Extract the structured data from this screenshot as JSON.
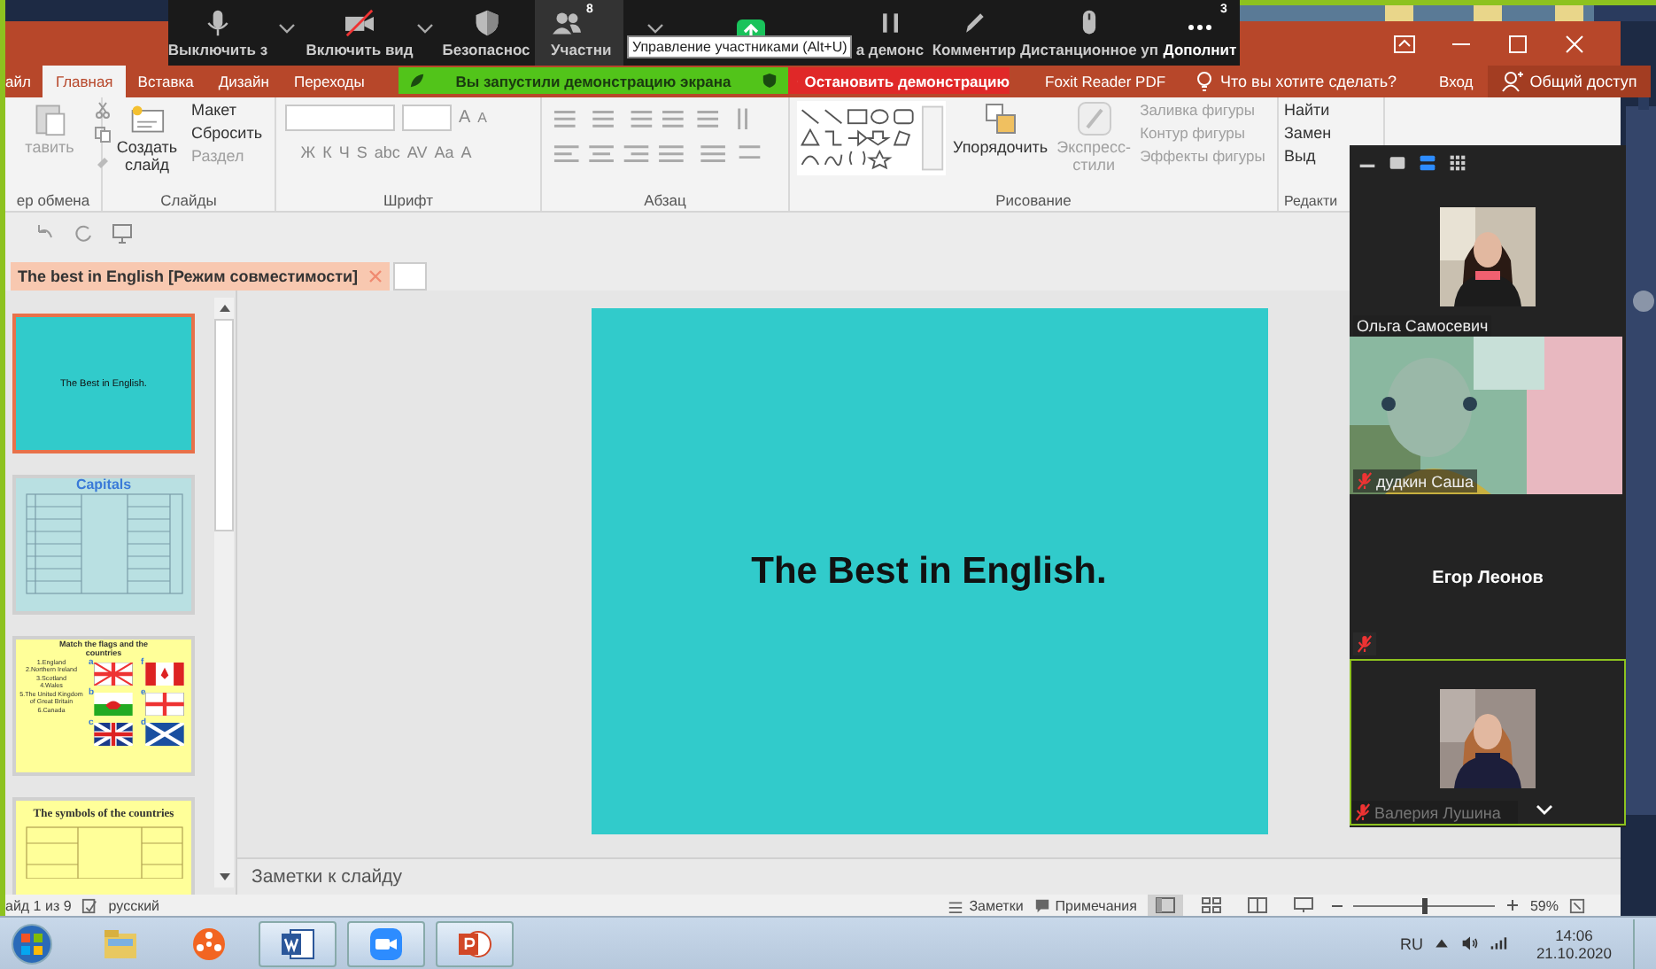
{
  "zoom_toolbar": {
    "buttons": [
      {
        "kind": "mic",
        "label": "Выключить з",
        "menu": true,
        "selected": false
      },
      {
        "kind": "video-off",
        "label": "Включить вид",
        "menu": true,
        "selected": false
      },
      {
        "kind": "shield",
        "label": "Безопаснос",
        "menu": false,
        "selected": false
      },
      {
        "kind": "participants",
        "label": "Участни",
        "badge": "8",
        "menu": true,
        "selected": true
      },
      {
        "kind": "share",
        "menu": false,
        "selected": false
      },
      {
        "kind": "pause",
        "label": "а демонс",
        "menu": false,
        "selected": false
      },
      {
        "kind": "pen",
        "label": "Комментир",
        "menu": false,
        "selected": false
      },
      {
        "kind": "remote",
        "label": "Дистанционное уп",
        "menu": false,
        "selected": false
      },
      {
        "kind": "more",
        "label": "Дополнит",
        "badge": "3",
        "menu": false,
        "selected": false
      }
    ],
    "tooltip": "Управление участниками (Alt+U)"
  },
  "share_banner": {
    "text": "Вы запустили демонстрацию экрана",
    "stop_button": "Остановить демонстрацию"
  },
  "powerpoint": {
    "tabs": [
      {
        "label": "айл",
        "selected": false
      },
      {
        "label": "Главная",
        "selected": true
      },
      {
        "label": "Вставка",
        "selected": false
      },
      {
        "label": "Дизайн",
        "selected": false
      },
      {
        "label": "Переходы",
        "selected": false
      }
    ],
    "foxit_tab": "Foxit Reader PDF",
    "tell_me": "Что вы хотите сделать?",
    "sign_in": "Вход",
    "share": "Общий доступ",
    "ribbon": [
      {
        "kind": "clipboard",
        "label": "ер обмена",
        "paste": "тавить"
      },
      {
        "kind": "slides",
        "label": "Слайды",
        "new_slide": "Создать слайд",
        "items": [
          {
            "label": "Макет",
            "disabled": false
          },
          {
            "label": "Сбросить",
            "disabled": false
          },
          {
            "label": "Раздел",
            "disabled": true
          }
        ]
      },
      {
        "kind": "font",
        "label": "Шрифт",
        "size_buttons": [
          "A",
          "A"
        ],
        "buttons": [
          "Ж",
          "К",
          "Ч",
          "S",
          "abc",
          "AV",
          "Aa",
          "A"
        ]
      },
      {
        "kind": "paragraph",
        "label": "Абзац"
      },
      {
        "kind": "drawing",
        "label": "Рисование",
        "arrange": "Упорядочить",
        "styles": "Экспресс-стили",
        "items": [
          {
            "label": "Заливка фигуры",
            "disabled": true
          },
          {
            "label": "Контур фигуры",
            "disabled": true
          },
          {
            "label": "Эффекты фигуры",
            "disabled": true
          }
        ]
      },
      {
        "kind": "editing",
        "label": "Редакти",
        "items": [
          {
            "label": "Найти",
            "disabled": false
          },
          {
            "label": "Замен",
            "disabled": false
          },
          {
            "label": "Выд",
            "disabled": false
          }
        ]
      }
    ],
    "document_tab": "The best in English [Режим совместимости]",
    "thumbnails": [
      {
        "kind": "title",
        "title": "The Best in English.",
        "selected": true
      },
      {
        "kind": "table",
        "title": "Capitals",
        "selected": false
      },
      {
        "kind": "flags",
        "title": "Match the flags and the countries",
        "items": [
          "1.England",
          "2.Northern Ireland",
          "3.Scotland",
          "4.Wales",
          "5.The United Kingdom of Great Britain",
          "6.Canada"
        ],
        "flags": [
          {
            "label": "a",
            "kind": "cross-saltire"
          },
          {
            "label": "f",
            "kind": "maple"
          },
          {
            "label": "b",
            "kind": "dragon"
          },
          {
            "label": "e",
            "kind": "cross"
          },
          {
            "label": "c",
            "kind": "union"
          },
          {
            "label": "d",
            "kind": "saltire"
          }
        ],
        "selected": false
      },
      {
        "kind": "serif-table",
        "title": "The symbols of the countries",
        "selected": false
      }
    ],
    "slide_title": "The Best in English.",
    "notes_placeholder": "Заметки к слайду",
    "status_bar": {
      "slide": "айд 1 из 9",
      "language": "русский",
      "notes": "Заметки",
      "comments": "Примечания",
      "zoom": "59%",
      "level": 0.5
    }
  },
  "participants_panel": {
    "views": [
      {
        "kind": "minimize",
        "selected": false
      },
      {
        "kind": "single",
        "selected": false
      },
      {
        "kind": "strip",
        "selected": true
      },
      {
        "kind": "grid",
        "selected": false
      }
    ],
    "tiles": [
      {
        "kind": "avatar",
        "name": "Ольга Самосевич",
        "muted": false,
        "speaking": false
      },
      {
        "kind": "camera",
        "name": "дудкин Саша",
        "muted": true,
        "speaking": false
      },
      {
        "kind": "name",
        "name": "Егор Леонов",
        "muted": true,
        "speaking": false
      },
      {
        "kind": "avatar",
        "name": "Валерия Лушина",
        "muted": true,
        "speaking": true
      }
    ]
  },
  "taskbar": {
    "apps": [
      {
        "kind": "explorer",
        "running": false
      },
      {
        "kind": "player",
        "running": false
      },
      {
        "kind": "word",
        "running": true
      },
      {
        "kind": "zoom",
        "running": true
      },
      {
        "kind": "powerpoint",
        "running": true
      }
    ],
    "language": "RU",
    "time": "14:06",
    "date": "21.10.2020"
  }
}
